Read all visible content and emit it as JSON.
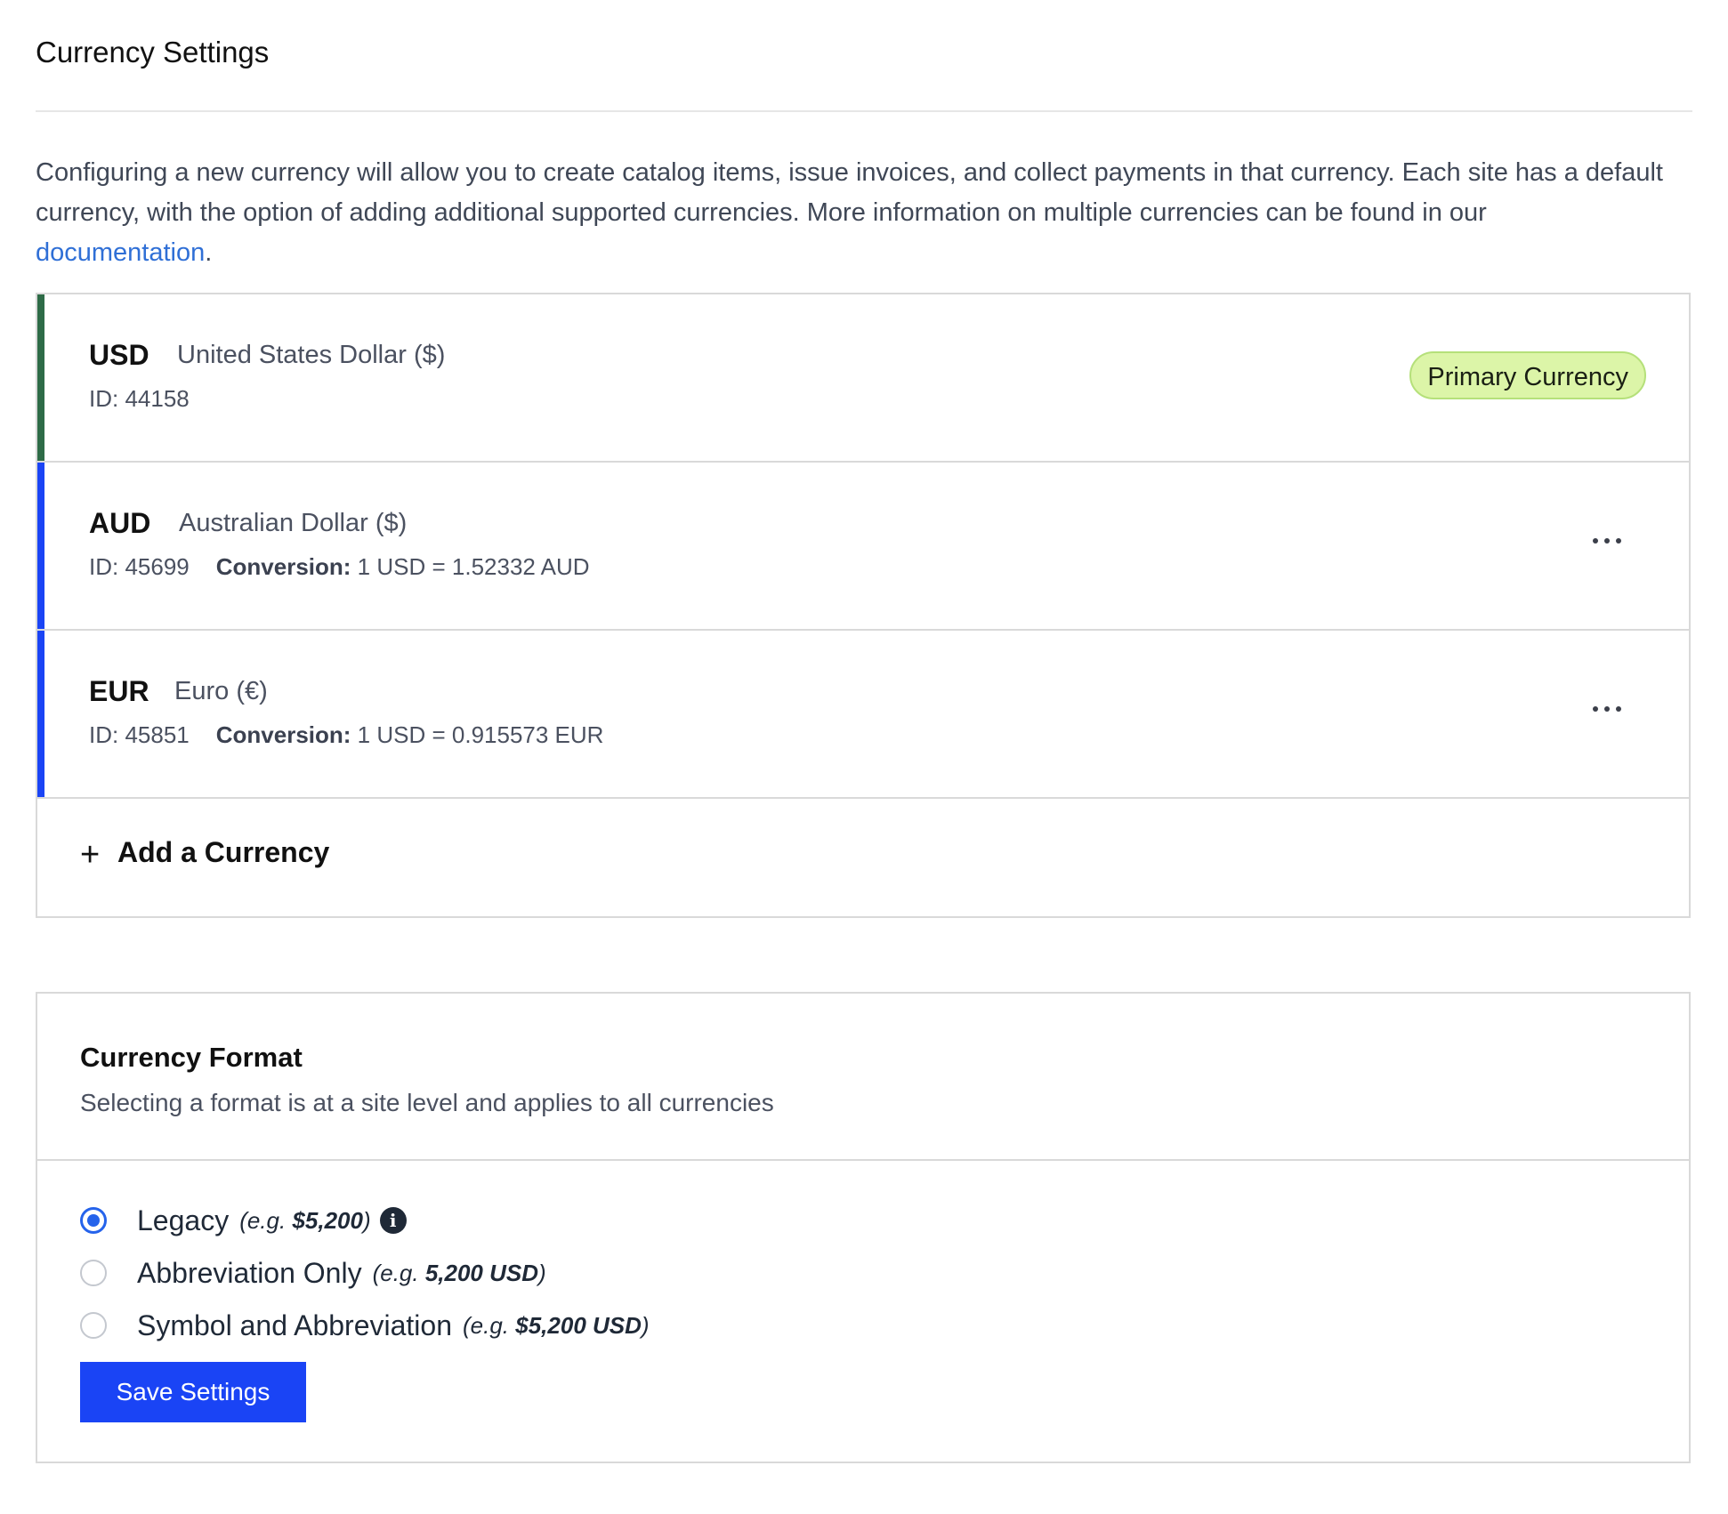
{
  "page": {
    "title": "Currency Settings",
    "description": {
      "text_before_link": "Configuring a new currency will allow you to create catalog items, issue invoices, and collect payments in that currency. Each site has a default currency, with the option of adding additional supported currencies. More information on multiple currencies can be found in our ",
      "link_text": "documentation",
      "text_after_link": "."
    }
  },
  "currencies": [
    {
      "code": "USD",
      "name": "United States Dollar ($)",
      "id_label": "ID: 44158",
      "badge": "Primary Currency",
      "accent_color": "#2e6b47"
    },
    {
      "code": "AUD",
      "name": "Australian Dollar ($)",
      "id_label": "ID: 45699",
      "conversion_label": "Conversion:",
      "conversion_value": "1 USD = 1.52332 AUD",
      "accent_color": "#1a44f5",
      "menu_icon": "more-horizontal-icon"
    },
    {
      "code": "EUR",
      "name": "Euro (€)",
      "id_label": "ID: 45851",
      "conversion_label": "Conversion:",
      "conversion_value": "1 USD = 0.915573 EUR",
      "accent_color": "#1a44f5",
      "menu_icon": "more-horizontal-icon"
    }
  ],
  "add_currency": {
    "icon": "plus-icon",
    "label": "Add a Currency"
  },
  "currency_format": {
    "title": "Currency Format",
    "subtitle": "Selecting a format is at a site level and applies to all currencies",
    "options": [
      {
        "label": "Legacy",
        "example_prefix": "(e.g. ",
        "example_value": "$5,200",
        "example_suffix": ")",
        "selected": true,
        "info_icon": "info-icon"
      },
      {
        "label": "Abbreviation Only",
        "example_prefix": "(e.g. ",
        "example_value": "5,200 USD",
        "example_suffix": ")",
        "selected": false
      },
      {
        "label": "Symbol and Abbreviation",
        "example_prefix": "(e.g. ",
        "example_value": "$5,200 USD",
        "example_suffix": ")",
        "selected": false
      }
    ],
    "save_label": "Save Settings"
  },
  "colors": {
    "link": "#2f6fd6",
    "primary_button": "#1a44f5",
    "radio_selected": "#2563eb",
    "badge_background": "#dcf5a8"
  }
}
